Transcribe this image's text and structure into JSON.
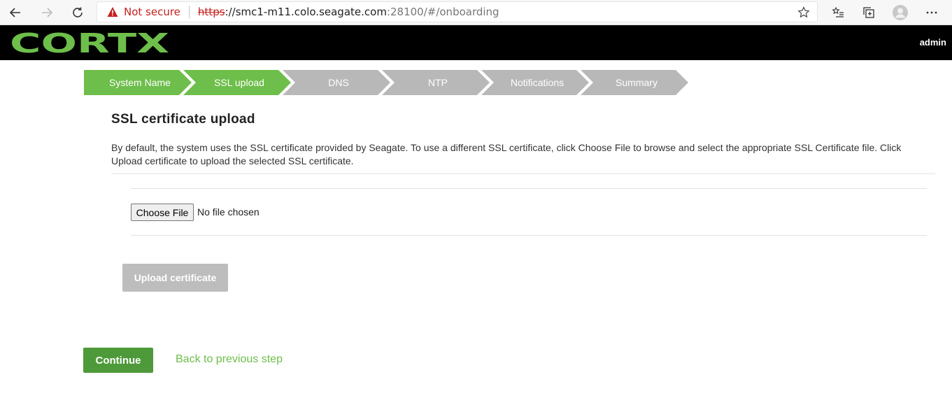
{
  "browser": {
    "security_label": "Not secure",
    "url_scheme": "https",
    "url_host": "://smc1-m11.colo.seagate.com",
    "url_rest": ":28100/#/onboarding"
  },
  "header": {
    "logo_text": "CORTX",
    "user": "admin"
  },
  "stepper": {
    "steps": [
      {
        "label": "System Name",
        "state": "done"
      },
      {
        "label": "SSL upload",
        "state": "done"
      },
      {
        "label": "DNS",
        "state": "todo"
      },
      {
        "label": "NTP",
        "state": "todo"
      },
      {
        "label": "Notifications",
        "state": "todo"
      },
      {
        "label": "Summary",
        "state": "todo"
      }
    ]
  },
  "main": {
    "title": "SSL certificate upload",
    "description": "By default, the system uses the SSL certificate provided by Seagate. To use a different SSL certificate, click Choose File to browse and select the appropriate SSL Certificate file. Click Upload certificate to upload the selected SSL certificate.",
    "choose_file_label": "Choose File",
    "no_file_text": "No file chosen",
    "upload_label": "Upload certificate"
  },
  "footer": {
    "continue_label": "Continue",
    "back_label": "Back to previous step"
  },
  "colors": {
    "accent": "#6ebe4b",
    "accent_dark": "#4e9a3a",
    "inactive": "#b8b8b8"
  }
}
